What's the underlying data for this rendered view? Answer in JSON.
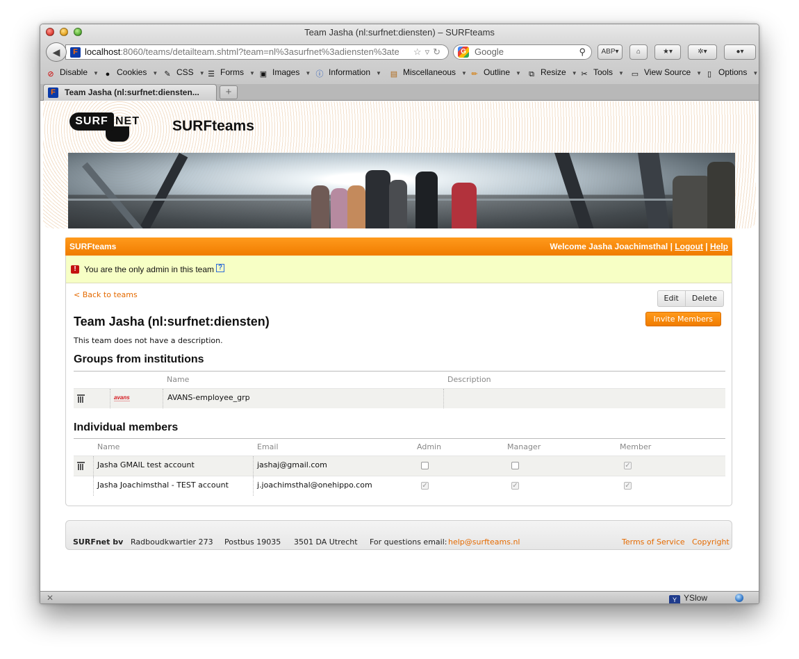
{
  "window": {
    "title": "Team Jasha (nl:surfnet:diensten) – SURFteams",
    "url_host": "localhost",
    "url_rest": ":8060/teams/detailteam.shtml?team=nl%3asurfnet%3adiensten%3ate",
    "search_placeholder": "Google"
  },
  "bookmarks": [
    "Disable",
    "Cookies",
    "CSS",
    "Forms",
    "Images",
    "Information",
    "Miscellaneous",
    "Outline",
    "Resize",
    "Tools",
    "View Source",
    "Options"
  ],
  "tab": {
    "label": "Team Jasha (nl:surfnet:diensten..."
  },
  "header": {
    "logo_left": "SURF",
    "logo_right": "NET",
    "site_title": "SURFteams"
  },
  "panel": {
    "bar_title": "SURFteams",
    "welcome": "Welcome Jasha Joachimsthal",
    "sep": "|",
    "logout": "Logout",
    "help": "Help",
    "alert": "You are the only admin in this team",
    "alert_help": "?",
    "back_link": "< Back to teams",
    "edit": "Edit",
    "delete": "Delete",
    "invite": "Invite Members",
    "team_title": "Team Jasha (nl:surfnet:diensten)",
    "team_desc": "This team does not have a description."
  },
  "groups": {
    "heading": "Groups from institutions",
    "columns": {
      "name": "Name",
      "description": "Description"
    },
    "rows": [
      {
        "logo": "avans",
        "name": "AVANS-employee_grp",
        "description": ""
      }
    ]
  },
  "members": {
    "heading": "Individual members",
    "columns": {
      "name": "Name",
      "email": "Email",
      "admin": "Admin",
      "manager": "Manager",
      "member": "Member"
    },
    "rows": [
      {
        "name": "Jasha GMAIL test account",
        "email": "jashaj@gmail.com",
        "admin": false,
        "manager": false,
        "member": true,
        "deletable": true
      },
      {
        "name": "Jasha Joachimsthal - TEST account",
        "email": "j.joachimsthal@onehippo.com",
        "admin": true,
        "manager": true,
        "member": true,
        "deletable": false
      }
    ]
  },
  "footer": {
    "company": "SURFnet bv",
    "street": "Radboudkwartier 273",
    "postbus": "Postbus 19035",
    "city": "3501 DA Utrecht",
    "questions": "For questions email:",
    "email": "help@surfteams.nl",
    "terms": "Terms of Service",
    "copyright": "Copyright"
  },
  "statusbar": {
    "yslow": "YSlow"
  },
  "colors": {
    "accent": "#f07c00",
    "alert_bg": "#f7ffc5",
    "link": "#e46a00"
  }
}
